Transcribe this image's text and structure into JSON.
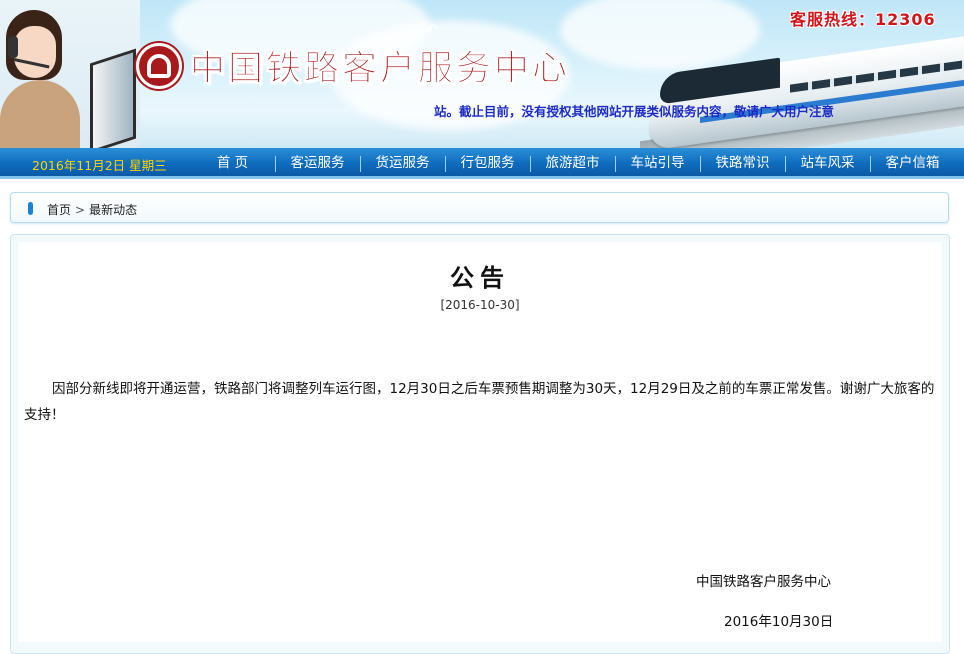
{
  "header": {
    "site_title": "中国铁路客户服务中心",
    "hotline": "客服热线：12306",
    "marquee": "站。截止目前，没有授权其他网站开展类似服务内容，敬请广大用户注意"
  },
  "nav": {
    "date": "2016年11月2日 星期三",
    "items": [
      {
        "label": "首 页"
      },
      {
        "label": "客运服务"
      },
      {
        "label": "货运服务"
      },
      {
        "label": "行包服务"
      },
      {
        "label": "旅游超市"
      },
      {
        "label": "车站引导"
      },
      {
        "label": "铁路常识"
      },
      {
        "label": "站车风采"
      },
      {
        "label": "客户信箱"
      }
    ]
  },
  "breadcrumb": {
    "home": "首页",
    "separator": ">",
    "current": "最新动态"
  },
  "article": {
    "title": "公告",
    "date": "[2016-10-30]",
    "body": "因部分新线即将开通运营，铁路部门将调整列车运行图，12月30日之后车票预售期调整为30天，12月29日及之前的车票正常发售。谢谢广大旅客的支持！",
    "signature": "中国铁路客户服务中心",
    "sign_date": "2016年10月30日"
  },
  "colors": {
    "brand_red": "#a8191c",
    "nav_blue": "#0f6cbd",
    "date_yellow": "#ffd400",
    "marquee_blue": "#1d2bc6"
  }
}
